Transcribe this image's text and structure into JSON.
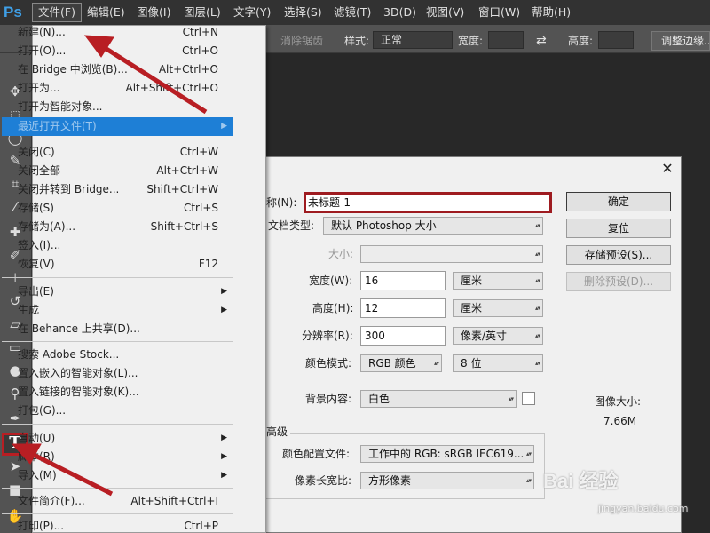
{
  "app": {
    "logo": "Ps"
  },
  "menubar": [
    {
      "id": "file",
      "label": "文件(F)"
    },
    {
      "id": "edit",
      "label": "编辑(E)"
    },
    {
      "id": "image",
      "label": "图像(I)"
    },
    {
      "id": "layer",
      "label": "图层(L)"
    },
    {
      "id": "type",
      "label": "文字(Y)"
    },
    {
      "id": "select",
      "label": "选择(S)"
    },
    {
      "id": "filter",
      "label": "滤镜(T)"
    },
    {
      "id": "3d",
      "label": "3D(D)"
    },
    {
      "id": "view",
      "label": "视图(V)"
    },
    {
      "id": "window",
      "label": "窗口(W)"
    },
    {
      "id": "help",
      "label": "帮助(H)"
    }
  ],
  "options_bar": {
    "antialias": "消除锯齿",
    "style_label": "样式:",
    "style_value": "正常",
    "width_label": "宽度:",
    "height_label": "高度:",
    "adjust_edge": "调整边缘..."
  },
  "file_menu": {
    "items": [
      {
        "label": "新建(N)...",
        "shortcut": "Ctrl+N"
      },
      {
        "label": "打开(O)...",
        "shortcut": "Ctrl+O"
      },
      {
        "label": "在 Bridge 中浏览(B)...",
        "shortcut": "Alt+Ctrl+O"
      },
      {
        "label": "打开为...",
        "shortcut": "Alt+Shift+Ctrl+O"
      },
      {
        "label": "打开为智能对象...",
        "shortcut": ""
      },
      {
        "label": "最近打开文件(T)",
        "shortcut": ""
      },
      {
        "label": "关闭(C)",
        "shortcut": "Ctrl+W"
      },
      {
        "label": "关闭全部",
        "shortcut": "Alt+Ctrl+W"
      },
      {
        "label": "关闭并转到 Bridge...",
        "shortcut": "Shift+Ctrl+W"
      },
      {
        "label": "存储(S)",
        "shortcut": "Ctrl+S"
      },
      {
        "label": "存储为(A)...",
        "shortcut": "Shift+Ctrl+S"
      },
      {
        "label": "签入(I)...",
        "shortcut": ""
      },
      {
        "label": "恢复(V)",
        "shortcut": "F12"
      },
      {
        "label": "导出(E)",
        "shortcut": ""
      },
      {
        "label": "生成",
        "shortcut": ""
      },
      {
        "label": "在 Behance 上共享(D)...",
        "shortcut": ""
      },
      {
        "label": "搜索 Adobe Stock...",
        "shortcut": ""
      },
      {
        "label": "置入嵌入的智能对象(L)...",
        "shortcut": ""
      },
      {
        "label": "置入链接的智能对象(K)...",
        "shortcut": ""
      },
      {
        "label": "打包(G)...",
        "shortcut": ""
      },
      {
        "label": "自动(U)",
        "shortcut": ""
      },
      {
        "label": "脚本(R)",
        "shortcut": ""
      },
      {
        "label": "导入(M)",
        "shortcut": ""
      },
      {
        "label": "文件简介(F)...",
        "shortcut": "Alt+Shift+Ctrl+I"
      },
      {
        "label": "打印(P)...",
        "shortcut": "Ctrl+P"
      }
    ]
  },
  "new_dialog": {
    "close": "✕",
    "name_label": "称(N):",
    "name_value": "未标题-1",
    "doc_type_label": "文档类型:",
    "doc_type_value": "默认 Photoshop 大小",
    "size_label": "大小:",
    "size_value": "",
    "width_label": "宽度(W):",
    "width_value": "16",
    "width_unit": "厘米",
    "height_label": "高度(H):",
    "height_value": "12",
    "height_unit": "厘米",
    "resolution_label": "分辨率(R):",
    "resolution_value": "300",
    "resolution_unit": "像素/英寸",
    "color_mode_label": "颜色模式:",
    "color_mode_value": "RGB 颜色",
    "bit_depth_value": "8 位",
    "bg_label": "背景内容:",
    "bg_value": "白色",
    "advanced_label": "高级",
    "color_profile_label": "颜色配置文件:",
    "color_profile_value": "工作中的 RGB: sRGB IEC619...",
    "pixel_aspect_label": "像素长宽比:",
    "pixel_aspect_value": "方形像素",
    "ok_button": "确定",
    "reset_button": "复位",
    "save_preset_button": "存储预设(S)...",
    "delete_preset_button": "删除预设(D)...",
    "image_size_label": "图像大小:",
    "image_size_value": "7.66M"
  },
  "watermark": {
    "main": "Bai 经验",
    "sub": "jingyan.baidu.com"
  },
  "colors": {
    "menubar": "#323232",
    "panel": "#535353",
    "highlight": "#1e7fd6",
    "annotation": "#b81e23"
  }
}
